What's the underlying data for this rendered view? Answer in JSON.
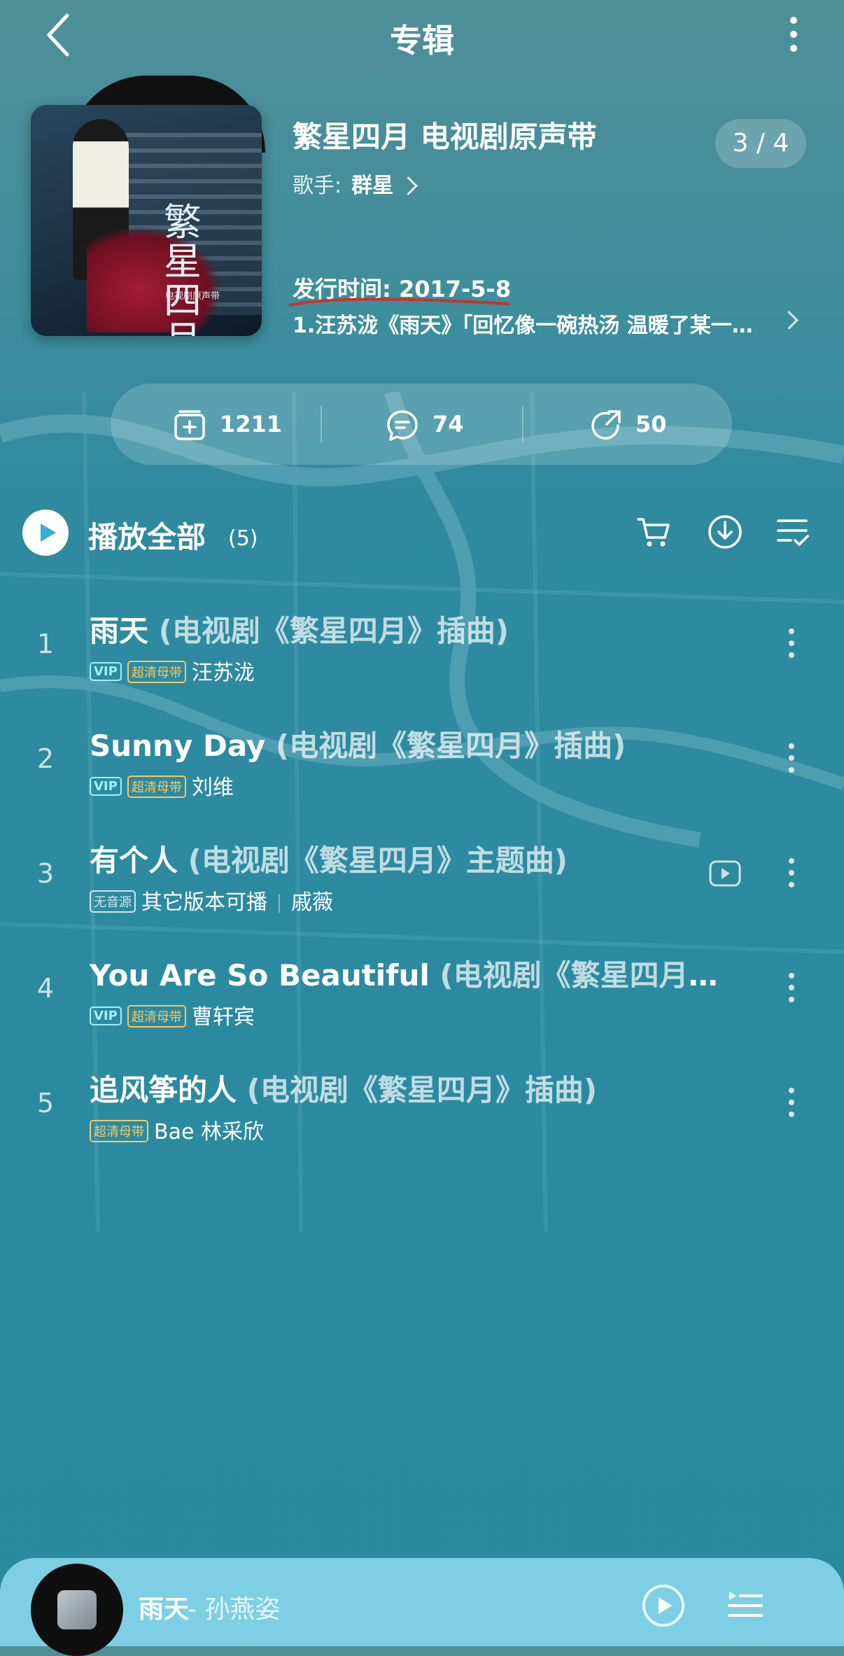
{
  "header": {
    "title": "专辑"
  },
  "album": {
    "cover_title": "繁星四月",
    "cover_subtitle": "电视剧原声带",
    "name": "繁星四月 电视剧原声带",
    "page_indicator": "3 / 4",
    "artist_label": "歌手:",
    "artist_name": "群星",
    "release": "发行时间: 2017-5-8",
    "description": "1.汪苏泷《雨天》「回忆像一碗热汤 温暖了某一…"
  },
  "stats": {
    "collect": "1211",
    "comments": "74",
    "shares": "50"
  },
  "playall": {
    "label": "播放全部",
    "count": "(5)"
  },
  "tracks": [
    {
      "num": "1",
      "title": "雨天",
      "sub": "(电视剧《繁星四月》插曲)",
      "badges": [
        "VIP",
        "超清母带"
      ],
      "artist": "汪苏泷"
    },
    {
      "num": "2",
      "title": "Sunny Day",
      "sub": "(电视剧《繁星四月》插曲)",
      "badges": [
        "VIP",
        "超清母带"
      ],
      "artist": "刘维"
    },
    {
      "num": "3",
      "title": "有个人",
      "sub": "(电视剧《繁星四月》主题曲)",
      "badges": [
        "无音源"
      ],
      "note": "其它版本可播",
      "artist": "戚薇"
    },
    {
      "num": "4",
      "title": "You Are So Beautiful",
      "sub": "(电视剧《繁星四月》…",
      "badges": [
        "VIP",
        "超清母带"
      ],
      "artist": "曹轩宾"
    },
    {
      "num": "5",
      "title": "追风筝的人",
      "sub": "(电视剧《繁星四月》插曲)",
      "badges": [
        "超清母带"
      ],
      "artist": "Bae 林采欣"
    }
  ],
  "player": {
    "song": "雨天",
    "singer": "- 孙燕姿"
  },
  "colors": {
    "accent": "#3aaed0",
    "vip": "#9ff0f8",
    "hq": "#f5c96a",
    "player_bg": "#7fcfe4"
  }
}
